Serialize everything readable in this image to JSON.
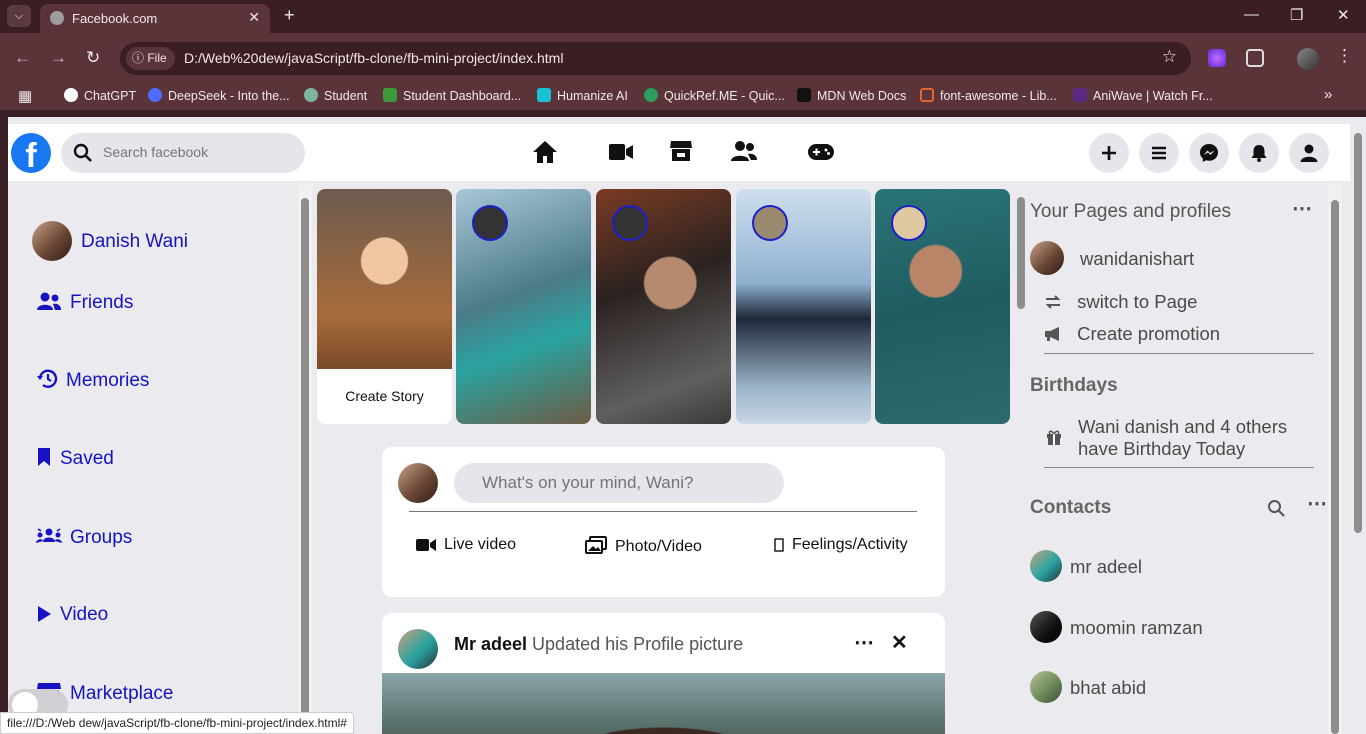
{
  "browser": {
    "tab_title": "Facebook.com",
    "file_chip": "File",
    "url": "D:/Web%20dew/javaScript/fb-clone/fb-mini-project/index.html",
    "bookmarks": [
      {
        "label": "ChatGPT",
        "color": "#ffffff"
      },
      {
        "label": "DeepSeek - Into the...",
        "color": "#4d6bfe"
      },
      {
        "label": "Student",
        "color": "#7fb3a0"
      },
      {
        "label": "Student Dashboard...",
        "color": "#3c9a3c"
      },
      {
        "label": "Humanize AI",
        "color": "#19c1d6"
      },
      {
        "label": "QuickRef.ME - Quic...",
        "color": "#2e9d5c"
      },
      {
        "label": "MDN Web Docs",
        "color": "#111111"
      },
      {
        "label": "font-awesome - Lib...",
        "color": "#e0662d"
      },
      {
        "label": "AniWave | Watch Fr...",
        "color": "#5b2a86"
      }
    ],
    "status_url": "file:///D:/Web dew/javaScript/fb-clone/fb-mini-project/index.html#"
  },
  "header": {
    "logo": "f",
    "search_placeholder": "Search facebook"
  },
  "left_sidebar": {
    "user_name": "Danish Wani",
    "items": [
      {
        "label": "Friends",
        "icon": "users-icon"
      },
      {
        "label": "Memories",
        "icon": "history-icon"
      },
      {
        "label": "Saved",
        "icon": "bookmark-icon"
      },
      {
        "label": "Groups",
        "icon": "groups-icon"
      },
      {
        "label": "Video",
        "icon": "play-icon"
      },
      {
        "label": "Marketplace",
        "icon": "store-icon"
      }
    ]
  },
  "stories": {
    "create_label": "Create Story"
  },
  "composer": {
    "placeholder": "What's on your mind, Wani?",
    "actions": [
      "Live video",
      "Photo/Video",
      "Feelings/Activity"
    ]
  },
  "post": {
    "author": "Mr adeel",
    "activity": "Updated his Profile picture"
  },
  "right_sidebar": {
    "pages_title": "Your Pages and profiles",
    "page_name": "wanidanishart",
    "switch_label": "switch to Page",
    "promo_label": "Create promotion",
    "birthdays_title": "Birthdays",
    "birthday_line1": "Wani danish and 4 others",
    "birthday_line2": "have Birthday Today",
    "contacts_title": "Contacts",
    "contacts": [
      "mr adeel",
      "moomin ramzan",
      "bhat abid"
    ]
  }
}
